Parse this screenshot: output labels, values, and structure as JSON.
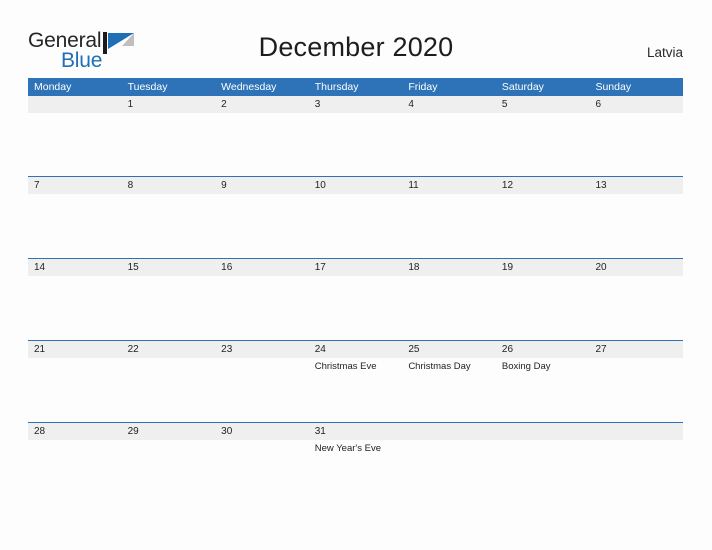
{
  "brand": {
    "name_part1": "General",
    "name_part2": "Blue",
    "flag_icon": "blue-triangle-flag-icon",
    "color_text": "#262626",
    "color_accent": "#1f6fb7"
  },
  "header": {
    "title": "December 2020",
    "region": "Latvia"
  },
  "theme": {
    "header_blue": "#2e73b8",
    "date_band_gray": "#efeff0",
    "page_background": "#fdfdfd",
    "text_color": "#232323"
  },
  "calendar": {
    "month": "December",
    "year": "2020",
    "weekday_headers": [
      "Monday",
      "Tuesday",
      "Wednesday",
      "Thursday",
      "Friday",
      "Saturday",
      "Sunday"
    ],
    "weeks": [
      {
        "ruled": false,
        "days": [
          {
            "date": "",
            "event": ""
          },
          {
            "date": "1",
            "event": ""
          },
          {
            "date": "2",
            "event": ""
          },
          {
            "date": "3",
            "event": ""
          },
          {
            "date": "4",
            "event": ""
          },
          {
            "date": "5",
            "event": ""
          },
          {
            "date": "6",
            "event": ""
          }
        ]
      },
      {
        "ruled": true,
        "days": [
          {
            "date": "7",
            "event": ""
          },
          {
            "date": "8",
            "event": ""
          },
          {
            "date": "9",
            "event": ""
          },
          {
            "date": "10",
            "event": ""
          },
          {
            "date": "11",
            "event": ""
          },
          {
            "date": "12",
            "event": ""
          },
          {
            "date": "13",
            "event": ""
          }
        ]
      },
      {
        "ruled": true,
        "days": [
          {
            "date": "14",
            "event": ""
          },
          {
            "date": "15",
            "event": ""
          },
          {
            "date": "16",
            "event": ""
          },
          {
            "date": "17",
            "event": ""
          },
          {
            "date": "18",
            "event": ""
          },
          {
            "date": "19",
            "event": ""
          },
          {
            "date": "20",
            "event": ""
          }
        ]
      },
      {
        "ruled": true,
        "days": [
          {
            "date": "21",
            "event": ""
          },
          {
            "date": "22",
            "event": ""
          },
          {
            "date": "23",
            "event": ""
          },
          {
            "date": "24",
            "event": "Christmas Eve"
          },
          {
            "date": "25",
            "event": "Christmas Day"
          },
          {
            "date": "26",
            "event": "Boxing Day"
          },
          {
            "date": "27",
            "event": ""
          }
        ]
      },
      {
        "ruled": true,
        "days": [
          {
            "date": "28",
            "event": ""
          },
          {
            "date": "29",
            "event": ""
          },
          {
            "date": "30",
            "event": ""
          },
          {
            "date": "31",
            "event": "New Year's Eve"
          },
          {
            "date": "",
            "event": ""
          },
          {
            "date": "",
            "event": ""
          },
          {
            "date": "",
            "event": ""
          }
        ]
      }
    ]
  }
}
